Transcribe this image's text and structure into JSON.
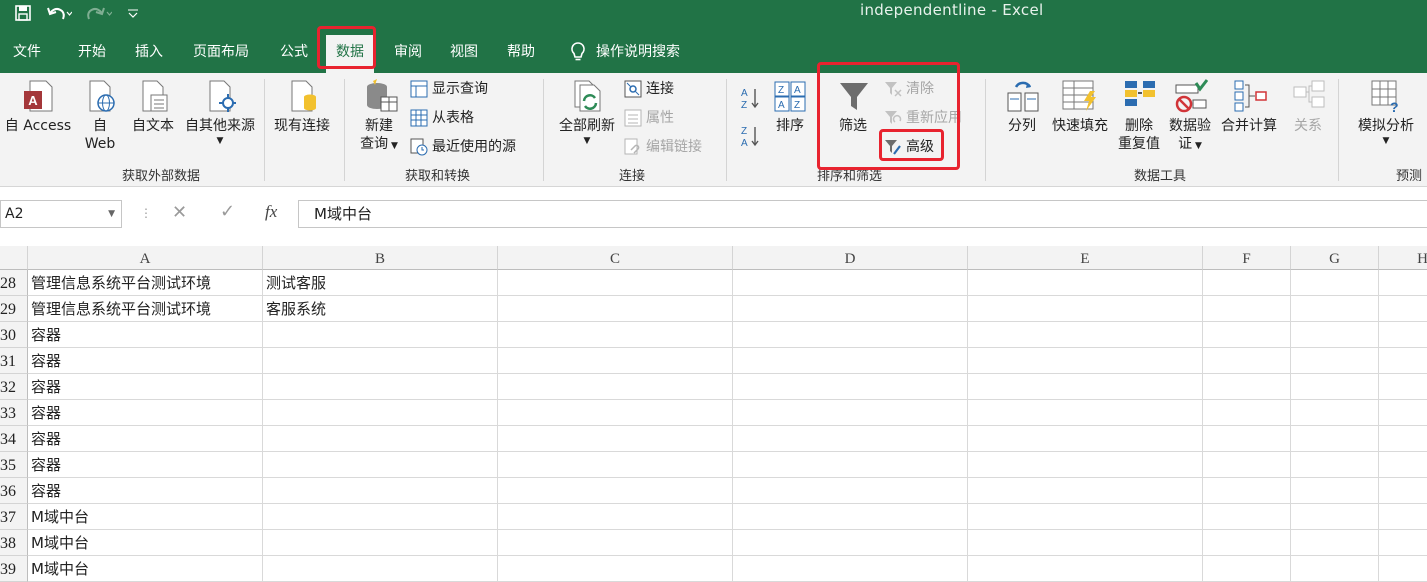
{
  "title": "independentline  -  Excel",
  "tabs": [
    "文件",
    "开始",
    "插入",
    "页面布局",
    "公式",
    "数据",
    "审阅",
    "视图",
    "帮助",
    "操作说明搜索"
  ],
  "ribbon": {
    "get_external": {
      "label": "获取外部数据",
      "access": "自 Access",
      "web1": "自",
      "web2": "Web",
      "text": "自文本",
      "other": "自其他来源",
      "existing": "现有连接"
    },
    "transform": {
      "label": "获取和转换",
      "new1": "新建",
      "new2": "查询",
      "show": "显示查询",
      "table": "从表格",
      "recent": "最近使用的源"
    },
    "connections": {
      "label": "连接",
      "refresh": "全部刷新",
      "conn": "连接",
      "props": "属性",
      "edit": "编辑链接"
    },
    "sortfilter": {
      "label": "排序和筛选",
      "sort": "排序",
      "filter": "筛选",
      "clear": "清除",
      "reapply": "重新应用",
      "advanced": "高级"
    },
    "datatools": {
      "label": "数据工具",
      "split": "分列",
      "flash": "快速填充",
      "remove1": "删除",
      "remove2": "重复值",
      "validate1": "数据验",
      "validate2": "证",
      "consolidate": "合并计算",
      "relations": "关系"
    },
    "forecast": {
      "label": "预测",
      "whatif": "模拟分析"
    }
  },
  "formula_bar": {
    "name_box": "A2",
    "content": "M域中台",
    "fx": "fx"
  },
  "columns": [
    "A",
    "B",
    "C",
    "D",
    "E",
    "F",
    "G",
    "H"
  ],
  "rows": [
    {
      "n": "28",
      "a": "管理信息系统平台测试环境",
      "b": "测试客服"
    },
    {
      "n": "29",
      "a": "管理信息系统平台测试环境",
      "b": "客服系统"
    },
    {
      "n": "30",
      "a": "容器",
      "b": ""
    },
    {
      "n": "31",
      "a": "容器",
      "b": ""
    },
    {
      "n": "32",
      "a": "容器",
      "b": ""
    },
    {
      "n": "33",
      "a": "容器",
      "b": ""
    },
    {
      "n": "34",
      "a": "容器",
      "b": ""
    },
    {
      "n": "35",
      "a": "容器",
      "b": ""
    },
    {
      "n": "36",
      "a": "容器",
      "b": ""
    },
    {
      "n": "37",
      "a": "M域中台",
      "b": ""
    },
    {
      "n": "38",
      "a": "M域中台",
      "b": ""
    },
    {
      "n": "39",
      "a": "M域中台",
      "b": ""
    }
  ],
  "colors": {
    "excel_green": "#217346",
    "highlight_red": "#e8232f"
  }
}
